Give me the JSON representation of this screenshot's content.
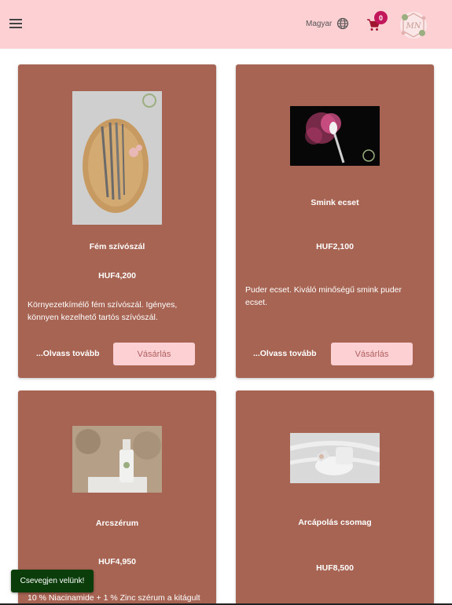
{
  "header": {
    "menu_icon": "hamburger-menu-icon",
    "language_label": "Magyar",
    "language_icon": "globe-icon",
    "cart_icon": "shopping-cart-icon",
    "cart_count": "0",
    "logo_icon": "floral-wreath-logo",
    "background_color": "#fdd0d3",
    "badge_color": "#c2185b"
  },
  "products": [
    {
      "title": "Fém szívószál",
      "price": "HUF4,200",
      "description": "Környezetkímélő fém szívószál. Igényes, könnyen kezelhető tartós szívószál.",
      "read_more": "...Olvass tovább",
      "buy_label": "Vásárlás"
    },
    {
      "title": "Smink ecset",
      "price": "HUF2,100",
      "description": "Puder ecset. Kiváló minőségű smink puder ecset.",
      "read_more": "...Olvass tovább",
      "buy_label": "Vásárlás"
    },
    {
      "title": "Arcszérum",
      "price": "HUF4,950",
      "description": "10 % Niacinamide + 1 % Zinc szérum a kitágult"
    },
    {
      "title": "Arcápolás csomag",
      "price": "HUF8,500"
    }
  ],
  "chat": {
    "label": "Csevegjen velünk!",
    "color": "#0b3d0b"
  },
  "colors": {
    "card": "#a76453",
    "button": "#fdd0d3"
  }
}
